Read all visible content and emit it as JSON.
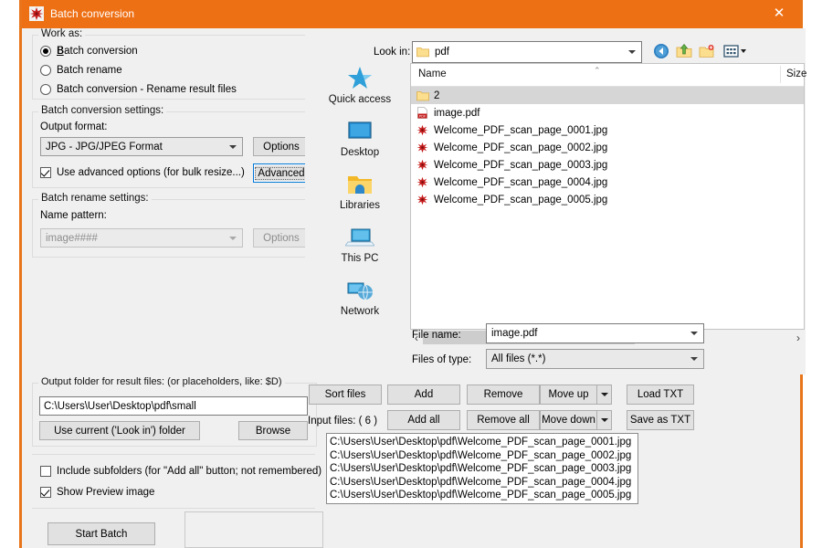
{
  "window": {
    "title": "Batch conversion",
    "close_label": "✕",
    "title_bar_color": "#ee7015",
    "border_color": "#e8751a"
  },
  "work_as": {
    "group_label": "Work as:",
    "options": [
      {
        "label": "Batch conversion",
        "selected": true
      },
      {
        "label": "Batch rename",
        "selected": false
      },
      {
        "label": "Batch conversion - Rename result files",
        "selected": false
      }
    ]
  },
  "conversion_settings": {
    "group_label": "Batch conversion settings:",
    "output_format_label": "Output format:",
    "output_format_value": "JPG - JPG/JPEG Format",
    "options_button": "Options",
    "advanced_checkbox_label": "Use advanced options (for bulk resize...)",
    "advanced_checkbox_checked": true,
    "advanced_button": "Advanced"
  },
  "rename_settings": {
    "group_label": "Batch rename settings:",
    "name_pattern_label": "Name pattern:",
    "name_pattern_value": "image####",
    "options_button": "Options",
    "disabled": true
  },
  "output_folder": {
    "group_label": "Output folder for result files: (or placeholders, like: $D)",
    "path_value": "C:\\Users\\User\\Desktop\\pdf\\small",
    "use_current_button": "Use current ('Look in') folder",
    "browse_button": "Browse"
  },
  "bottom_options": {
    "include_subfolders_label": "Include subfolders (for \"Add all\" button; not remembered)",
    "include_subfolders_checked": false,
    "show_preview_label": "Show Preview image",
    "show_preview_checked": true,
    "start_batch_button": "Start Batch"
  },
  "file_dialog": {
    "look_in_label": "Look in:",
    "look_in_value": "pdf",
    "toolbar_icons": [
      "back-icon",
      "up-folder-icon",
      "new-folder-icon",
      "view-mode-icon"
    ],
    "places": [
      {
        "label": "Quick access",
        "icon": "quick-access-star-icon"
      },
      {
        "label": "Desktop",
        "icon": "desktop-monitor-icon"
      },
      {
        "label": "Libraries",
        "icon": "libraries-folder-icon"
      },
      {
        "label": "This PC",
        "icon": "this-pc-laptop-icon"
      },
      {
        "label": "Network",
        "icon": "network-globe-icon"
      }
    ],
    "columns": [
      "Name",
      "Size"
    ],
    "rows": [
      {
        "name": "2",
        "icon": "folder-icon",
        "selected": true
      },
      {
        "name": "image.pdf",
        "icon": "pdf-icon",
        "selected": false
      },
      {
        "name": "Welcome_PDF_scan_page_0001.jpg",
        "icon": "irfanview-icon",
        "selected": false
      },
      {
        "name": "Welcome_PDF_scan_page_0002.jpg",
        "icon": "irfanview-icon",
        "selected": false
      },
      {
        "name": "Welcome_PDF_scan_page_0003.jpg",
        "icon": "irfanview-icon",
        "selected": false
      },
      {
        "name": "Welcome_PDF_scan_page_0004.jpg",
        "icon": "irfanview-icon",
        "selected": false
      },
      {
        "name": "Welcome_PDF_scan_page_0005.jpg",
        "icon": "irfanview-icon",
        "selected": false
      }
    ],
    "file_name_label": "File name:",
    "file_name_value": "image.pdf",
    "files_of_type_label": "Files of type:",
    "files_of_type_value": "All files (*.*)"
  },
  "file_actions": {
    "sort_files": "Sort files",
    "add": "Add",
    "remove": "Remove",
    "move_up": "Move up",
    "load_txt": "Load TXT",
    "add_all": "Add all",
    "remove_all": "Remove all",
    "move_down": "Move down",
    "save_as_txt": "Save as TXT",
    "input_files_label": "Input files: ( 6 )"
  },
  "input_files": [
    "C:\\Users\\User\\Desktop\\pdf\\Welcome_PDF_scan_page_0001.jpg",
    "C:\\Users\\User\\Desktop\\pdf\\Welcome_PDF_scan_page_0002.jpg",
    "C:\\Users\\User\\Desktop\\pdf\\Welcome_PDF_scan_page_0003.jpg",
    "C:\\Users\\User\\Desktop\\pdf\\Welcome_PDF_scan_page_0004.jpg",
    "C:\\Users\\User\\Desktop\\pdf\\Welcome_PDF_scan_page_0005.jpg"
  ]
}
